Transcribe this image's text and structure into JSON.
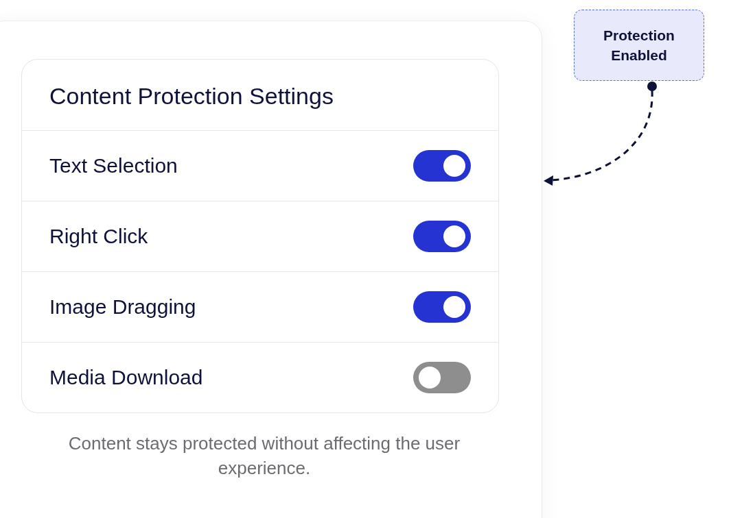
{
  "card": {
    "title": "Content Protection Settings",
    "settings": [
      {
        "label": "Text Selection",
        "on": true
      },
      {
        "label": "Right Click",
        "on": true
      },
      {
        "label": "Image Dragging",
        "on": true
      },
      {
        "label": "Media Download",
        "on": false
      }
    ]
  },
  "caption": "Content stays protected without affecting the user experience.",
  "callout": {
    "label": "Protection Enabled"
  }
}
